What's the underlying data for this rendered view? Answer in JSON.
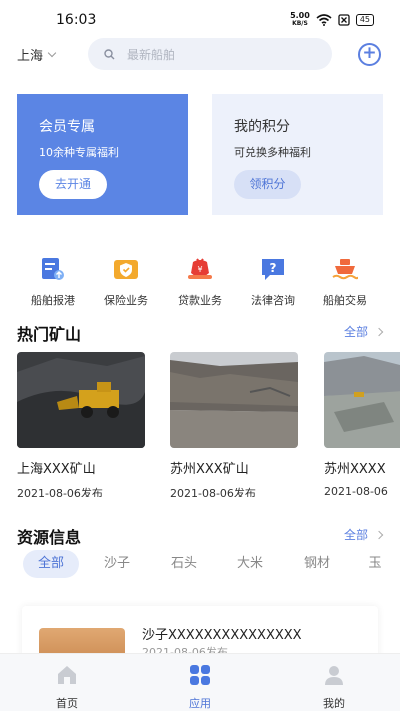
{
  "status_bar": {
    "time": "16:03",
    "network_speed": "5.00",
    "speed_unit": "KB/S",
    "battery": "45"
  },
  "header": {
    "city": "上海",
    "search_placeholder": "最新船舶"
  },
  "cards": {
    "member": {
      "title": "会员专属",
      "subtitle": "10余种专属福利",
      "button": "去开通"
    },
    "points": {
      "title": "我的积分",
      "subtitle": "可兑换多种福利",
      "button": "领积分"
    }
  },
  "services": [
    {
      "label": "船舶报港",
      "icon": "ship-report-icon"
    },
    {
      "label": "保险业务",
      "icon": "insurance-icon"
    },
    {
      "label": "贷款业务",
      "icon": "loan-icon"
    },
    {
      "label": "法律咨询",
      "icon": "legal-consult-icon"
    },
    {
      "label": "船舶交易",
      "icon": "ship-trade-icon"
    }
  ],
  "hot_mines": {
    "title": "热门矿山",
    "more": "全部",
    "items": [
      {
        "name": "上海XXX矿山",
        "date": "2021-08-06发布"
      },
      {
        "name": "苏州XXX矿山",
        "date": "2021-08-06发布"
      },
      {
        "name": "苏州XXXX",
        "date": "2021-08-06"
      }
    ]
  },
  "resources": {
    "title": "资源信息",
    "more": "全部",
    "filters": [
      "全部",
      "沙子",
      "石头",
      "大米",
      "钢材",
      "玉"
    ],
    "active_filter": "全部",
    "items": [
      {
        "title": "沙子XXXXXXXXXXXXXXX",
        "date": "2021-08-06发布"
      }
    ]
  },
  "tabbar": {
    "items": [
      {
        "label": "首页",
        "icon": "home-icon"
      },
      {
        "label": "应用",
        "icon": "apps-icon"
      },
      {
        "label": "我的",
        "icon": "profile-icon"
      }
    ],
    "active": "应用"
  },
  "colors": {
    "accent": "#5b85e4",
    "accent_text": "#4f75d6",
    "soft_bg": "#edf1fb"
  }
}
